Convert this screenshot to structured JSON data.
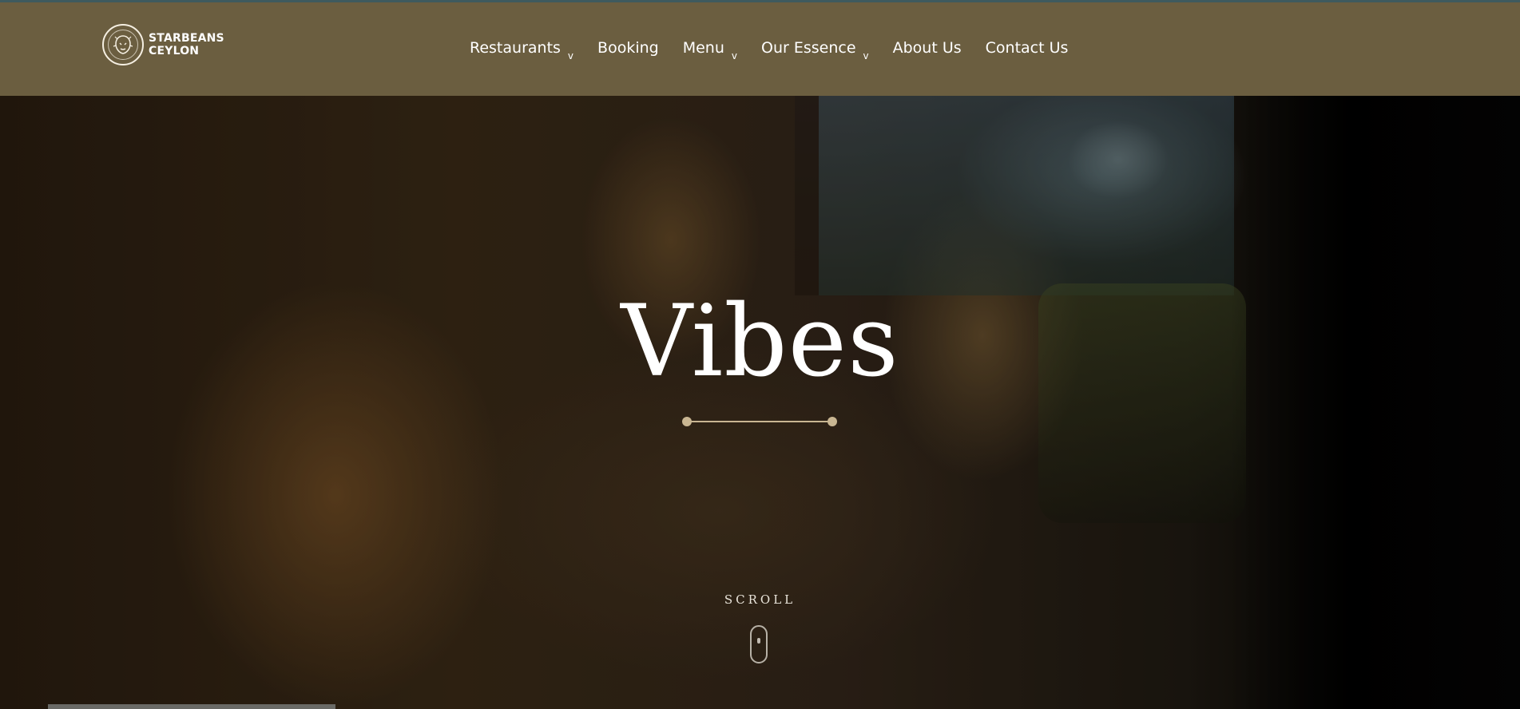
{
  "brand": {
    "name_line1": "STARBEANS",
    "name_line2": "CEYLON",
    "logo_icon": "lion-seal-icon"
  },
  "nav": {
    "items": [
      {
        "label": "Restaurants",
        "has_dropdown": true
      },
      {
        "label": "Booking",
        "has_dropdown": false
      },
      {
        "label": "Menu",
        "has_dropdown": true
      },
      {
        "label": "Our Essence",
        "has_dropdown": true
      },
      {
        "label": "About Us",
        "has_dropdown": false
      },
      {
        "label": "Contact Us",
        "has_dropdown": false
      }
    ],
    "caret_glyph": "v"
  },
  "hero": {
    "title": "Vibes",
    "scroll_label": "SCROLL",
    "scroll_icon": "mouse-scroll-icon"
  },
  "colors": {
    "header_bg": "#6b5e40",
    "accent": "#c9b692",
    "text": "#ffffff"
  }
}
